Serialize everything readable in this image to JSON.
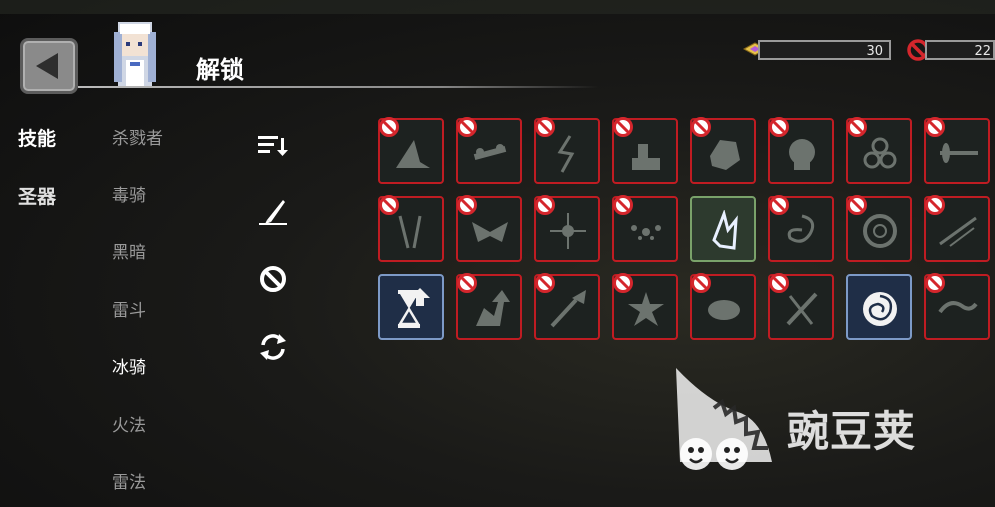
{
  "header": {
    "title": "解锁"
  },
  "resources": [
    {
      "icon": "gem-icon",
      "value": "30"
    },
    {
      "icon": "forbidden-icon",
      "value": "22"
    }
  ],
  "categories": [
    {
      "label": "技能",
      "active": true
    },
    {
      "label": "圣器",
      "active": false
    }
  ],
  "classes": [
    {
      "label": "杀戮者",
      "active": false
    },
    {
      "label": "毒骑",
      "active": false
    },
    {
      "label": "黑暗",
      "active": false
    },
    {
      "label": "雷斗",
      "active": false
    },
    {
      "label": "冰骑",
      "active": true
    },
    {
      "label": "火法",
      "active": false
    },
    {
      "label": "雷法",
      "active": false
    }
  ],
  "tools": [
    "sort-icon",
    "edit-icon",
    "ban-icon",
    "refresh-icon"
  ],
  "skills": [
    [
      {
        "icon": "slash-skill-icon",
        "state": "locked"
      },
      {
        "icon": "chain-skill-icon",
        "state": "locked"
      },
      {
        "icon": "lightning-skill-icon",
        "state": "locked"
      },
      {
        "icon": "hand-skill-icon",
        "state": "locked"
      },
      {
        "icon": "rock-skill-icon",
        "state": "locked"
      },
      {
        "icon": "skull-skill-icon",
        "state": "locked"
      },
      {
        "icon": "biohazard-skill-icon",
        "state": "locked"
      },
      {
        "icon": "spear-skill-icon",
        "state": "locked"
      }
    ],
    [
      {
        "icon": "swords-skill-icon",
        "state": "locked"
      },
      {
        "icon": "bat-skill-icon",
        "state": "locked"
      },
      {
        "icon": "burst-skill-icon",
        "state": "locked"
      },
      {
        "icon": "scatter-skill-icon",
        "state": "locked"
      },
      {
        "icon": "ice-crystal-skill-icon",
        "state": "unlocked"
      },
      {
        "icon": "vortex-skill-icon",
        "state": "locked"
      },
      {
        "icon": "ring-skill-icon",
        "state": "locked"
      },
      {
        "icon": "streak-skill-icon",
        "state": "locked"
      }
    ],
    [
      {
        "icon": "hourglass-upgrade-icon",
        "state": "selected"
      },
      {
        "icon": "arrow-up-skill-icon",
        "state": "locked"
      },
      {
        "icon": "arrow-up-sword-skill-icon",
        "state": "locked"
      },
      {
        "icon": "star-burst-skill-icon",
        "state": "locked"
      },
      {
        "icon": "cloud-skill-icon",
        "state": "locked"
      },
      {
        "icon": "crossed-blades-skill-icon",
        "state": "locked"
      },
      {
        "icon": "spiral-shield-skill-icon",
        "state": "selected"
      },
      {
        "icon": "wind-skill-icon",
        "state": "locked"
      }
    ]
  ],
  "watermark": {
    "text": "豌豆荚"
  }
}
